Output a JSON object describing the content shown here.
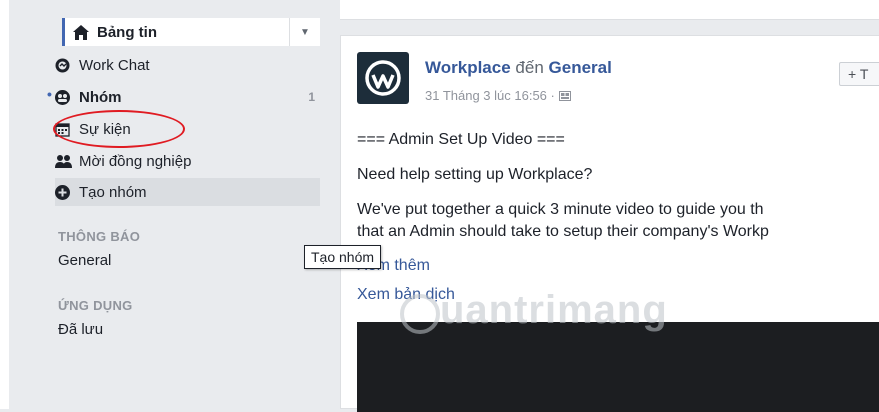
{
  "sidebar": {
    "news_feed": "Bảng tin",
    "work_chat": "Work Chat",
    "groups": "Nhóm",
    "groups_count": "1",
    "events": "Sự kiện",
    "invite": "Mời đồng nghiệp",
    "create_group": "Tạo nhóm",
    "notifications_title": "THÔNG BÁO",
    "notifications_item": "General",
    "apps_title": "ỨNG DỤNG",
    "apps_item": "Đã lưu"
  },
  "tooltip": "Tạo nhóm",
  "post": {
    "author": "Workplace",
    "to_word": "đến",
    "group": "General",
    "time": "31 Tháng 3 lúc 16:56 ·",
    "follow_label": "+ T",
    "line1": "=== Admin Set Up Video ===",
    "line2": "Need help setting up Workplace?",
    "line3": "We've put together a quick 3 minute video to guide you th",
    "line4": "that an Admin should take to setup their company's Workp",
    "see_more": "Xem thêm",
    "see_translation": "Xem bản dịch"
  },
  "watermark": "uantrimang",
  "colors": {
    "accent": "#4267b2",
    "link": "#365899",
    "highlight_red": "#e01b22"
  }
}
